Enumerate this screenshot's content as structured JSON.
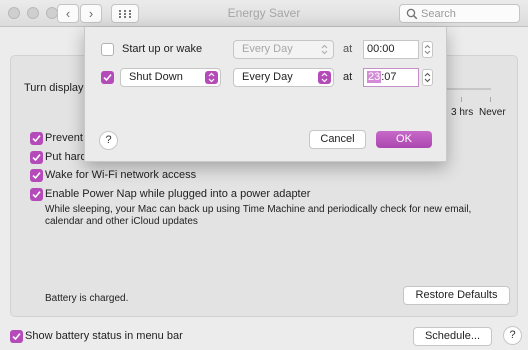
{
  "window": {
    "title": "Energy Saver"
  },
  "toolbar": {
    "back_glyph": "‹",
    "forward_glyph": "›",
    "search_placeholder": "Search"
  },
  "panel": {
    "turn_display_label": "Turn display",
    "slider_labels": {
      "three_hrs": "3 hrs",
      "never": "Never"
    },
    "options": [
      {
        "label": "Prevent",
        "checked": true
      },
      {
        "label": "Put hard",
        "checked": true
      },
      {
        "label": "Wake for Wi-Fi network access",
        "checked": true
      },
      {
        "label": "Enable Power Nap while plugged into a power adapter",
        "checked": true
      }
    ],
    "power_nap_desc_line1": "While sleeping, your Mac can back up using Time Machine and periodically check for new email,",
    "power_nap_desc_line2": "calendar and other iCloud updates",
    "battery_status": "Battery is charged.",
    "restore_defaults": "Restore Defaults"
  },
  "footer": {
    "show_battery_label": "Show battery status in menu bar",
    "show_battery_checked": true,
    "schedule_button": "Schedule...",
    "help_glyph": "?"
  },
  "sheet": {
    "row1": {
      "checked": false,
      "label": "Start up or wake",
      "day": "Every Day",
      "at": "at",
      "time": "00:00"
    },
    "row2": {
      "checked": true,
      "action": "Shut Down",
      "day": "Every Day",
      "at": "at",
      "time_hour": "23",
      "time_rest": ":07"
    },
    "help_glyph": "?",
    "cancel": "Cancel",
    "ok": "OK"
  },
  "colors": {
    "accent": "#b44bb8",
    "selection": "#d48ad6"
  }
}
